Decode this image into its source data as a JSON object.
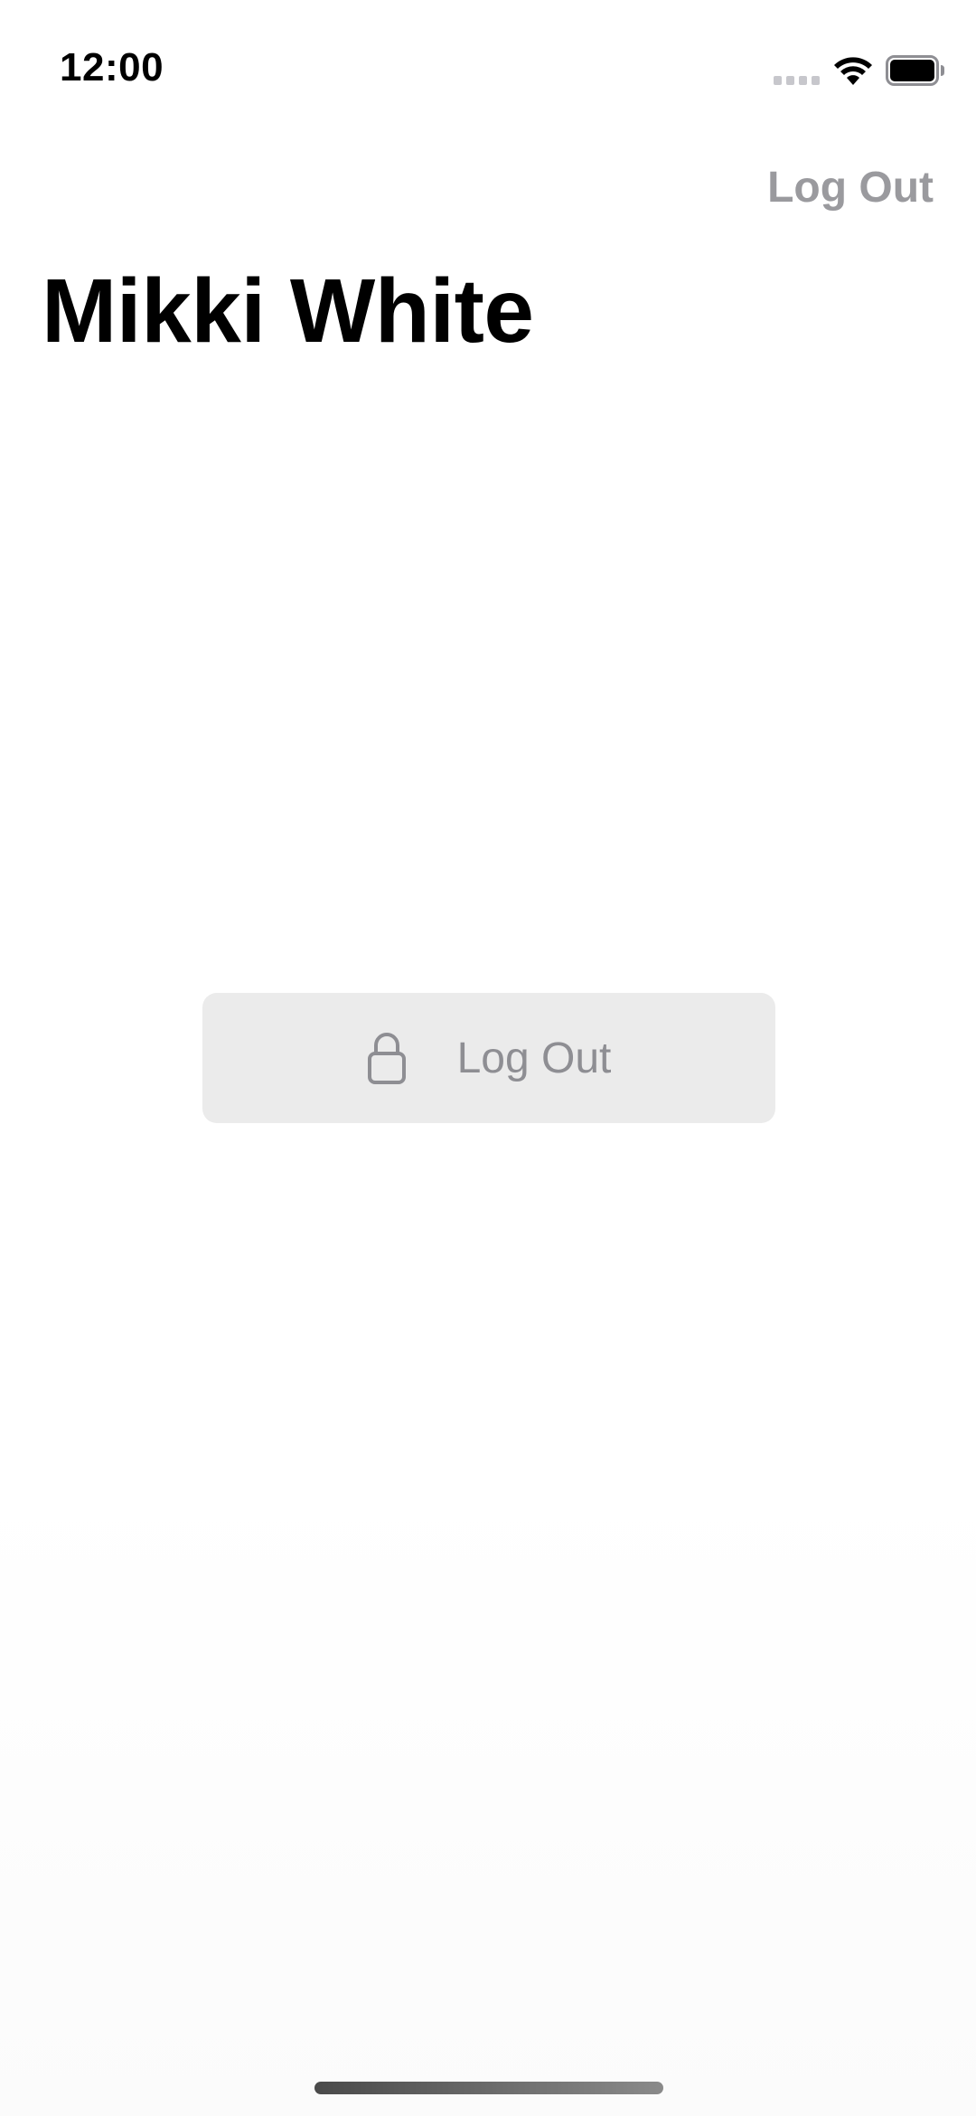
{
  "status_bar": {
    "time": "12:00",
    "icons": [
      "signal-icon",
      "wifi-icon",
      "battery-icon"
    ]
  },
  "nav": {
    "logout_label": "Log Out"
  },
  "header": {
    "title": "Mikki White"
  },
  "main": {
    "logout_button": {
      "label": "Log Out",
      "icon": "lock-icon"
    }
  },
  "colors": {
    "text_primary": "#000000",
    "text_secondary": "#8e8e93",
    "button_background": "#ebebeb",
    "background": "#ffffff"
  }
}
